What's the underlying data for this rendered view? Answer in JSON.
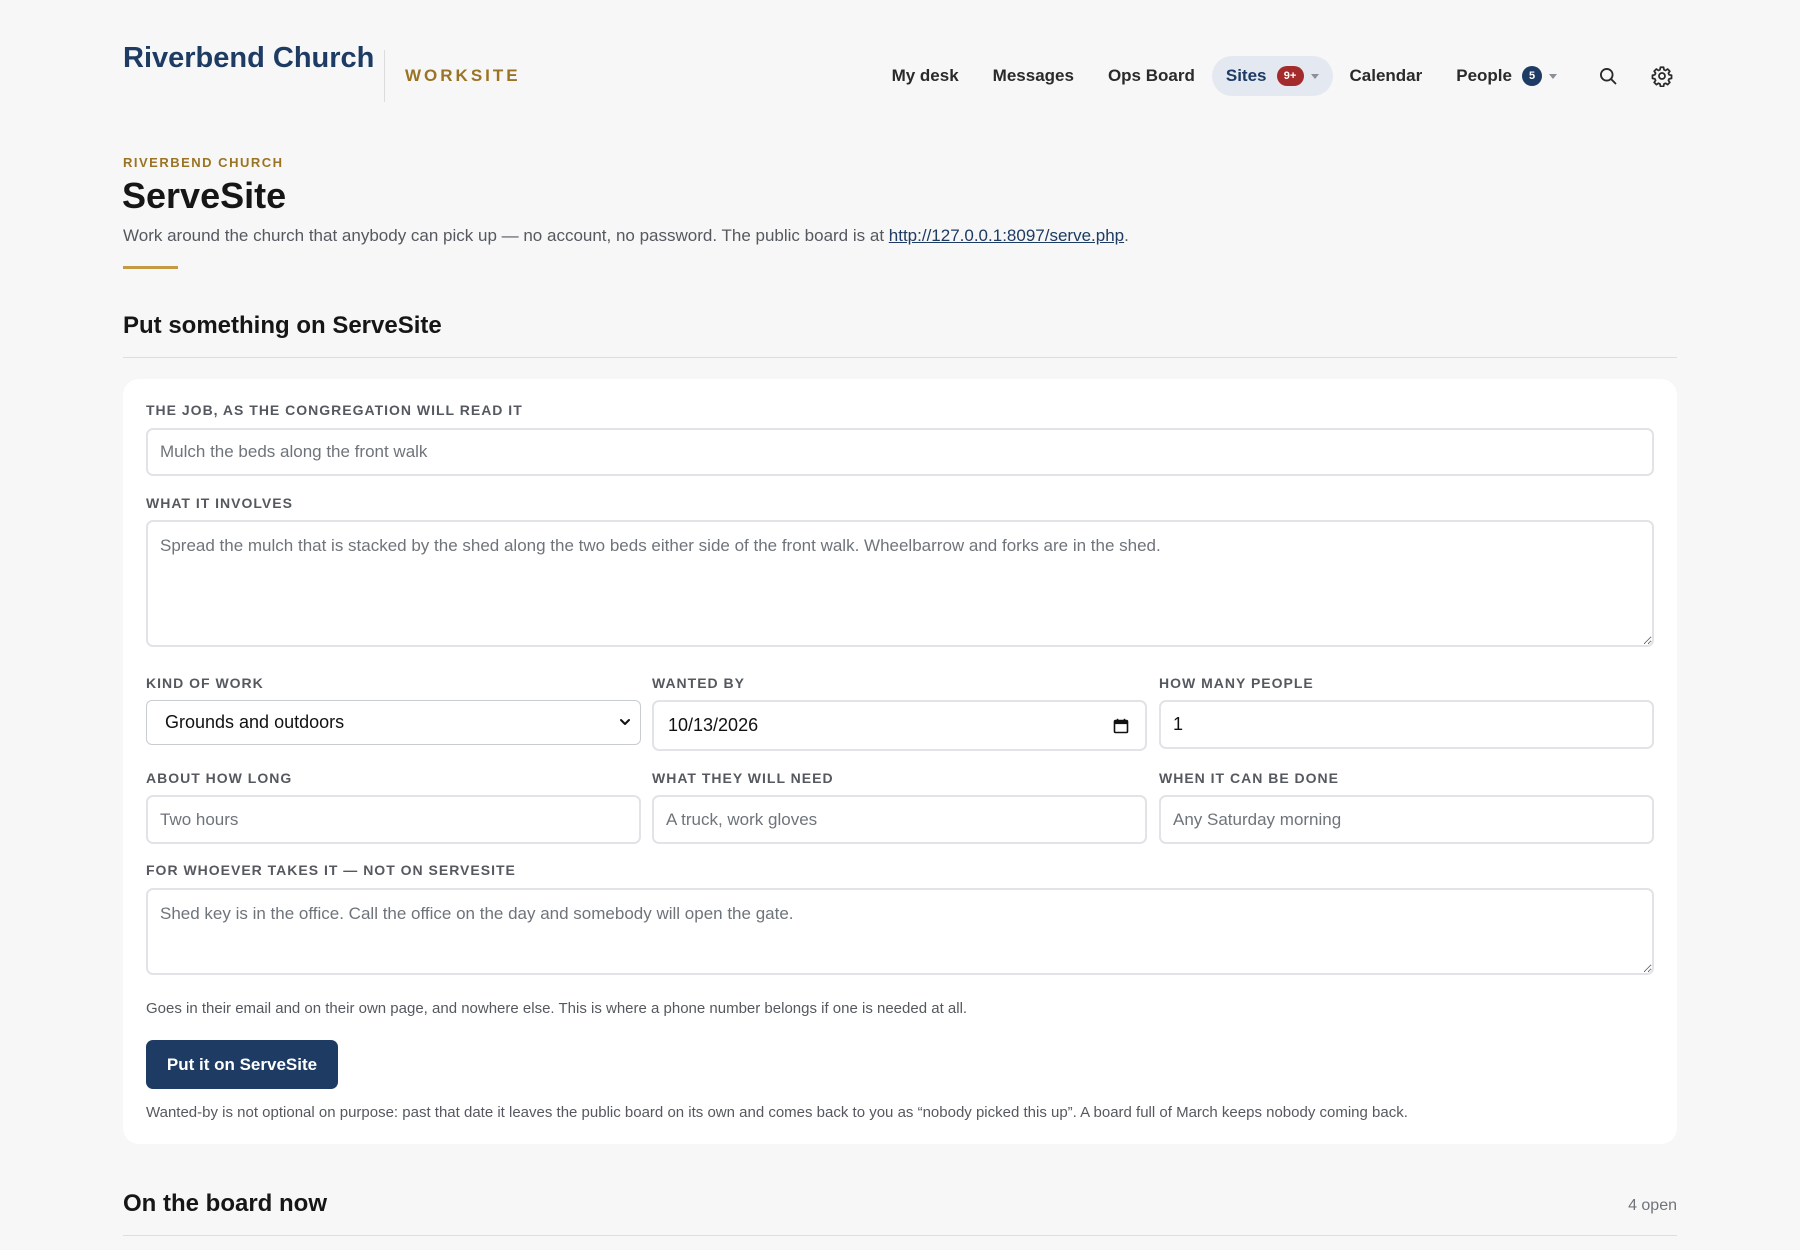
{
  "header": {
    "brand": "Riverbend Church",
    "brand_sub": "WORKSITE",
    "nav": [
      {
        "label": "My desk"
      },
      {
        "label": "Messages"
      },
      {
        "label": "Ops Board"
      },
      {
        "label": "Sites",
        "badge": "9+",
        "active": true
      },
      {
        "label": "Calendar"
      },
      {
        "label": "People",
        "badge": "5"
      }
    ],
    "icons": [
      "search-icon",
      "gear-icon"
    ]
  },
  "page": {
    "eyebrow": "RIVERBEND CHURCH",
    "title": "ServeSite",
    "intro": "Work around the church that anybody can pick up — no account, no password. The public board is at ",
    "intro_link": "http://127.0.0.1:8097/serve.php",
    "intro_end": "."
  },
  "form_section": {
    "title": "Put something on ServeSite",
    "job_label": "THE JOB, AS THE CONGREGATION WILL READ IT",
    "job_placeholder": "Mulch the beds along the front walk",
    "involves_label": "WHAT IT INVOLVES",
    "involves_placeholder": "Spread the mulch that is stacked by the shed along the two beds either side of the front walk. Wheelbarrow and forks are in the shed.",
    "kind_label": "KIND OF WORK",
    "kind_value": "Grounds and outdoors",
    "wanted_label": "WANTED BY",
    "wanted_value": "10/13/2026",
    "people_label": "HOW MANY PEOPLE",
    "people_value": "1",
    "howlong_label": "ABOUT HOW LONG",
    "howlong_placeholder": "Two hours",
    "need_label": "WHAT THEY WILL NEED",
    "need_placeholder": "A truck, work gloves",
    "when_label": "WHEN IT CAN BE DONE",
    "when_placeholder": "Any Saturday morning",
    "private_label": "FOR WHOEVER TAKES IT — NOT ON SERVESITE",
    "private_placeholder": "Shed key is in the office. Call the office on the day and somebody will open the gate.",
    "private_help": "Goes in their email and on their own page, and nowhere else. This is where a phone number belongs if one is needed at all.",
    "submit_label": "Put it on ServeSite",
    "footnote": "Wanted-by is not optional on purpose: past that date it leaves the public board on its own and comes back to you as “nobody picked this up”. A board full of March keeps nobody coming back."
  },
  "board_section": {
    "title": "On the board now",
    "count": "4 open"
  },
  "colors": {
    "brand_navy": "#1d3b63",
    "accent_gold": "#9a7424",
    "badge_red": "#a32b2b"
  }
}
